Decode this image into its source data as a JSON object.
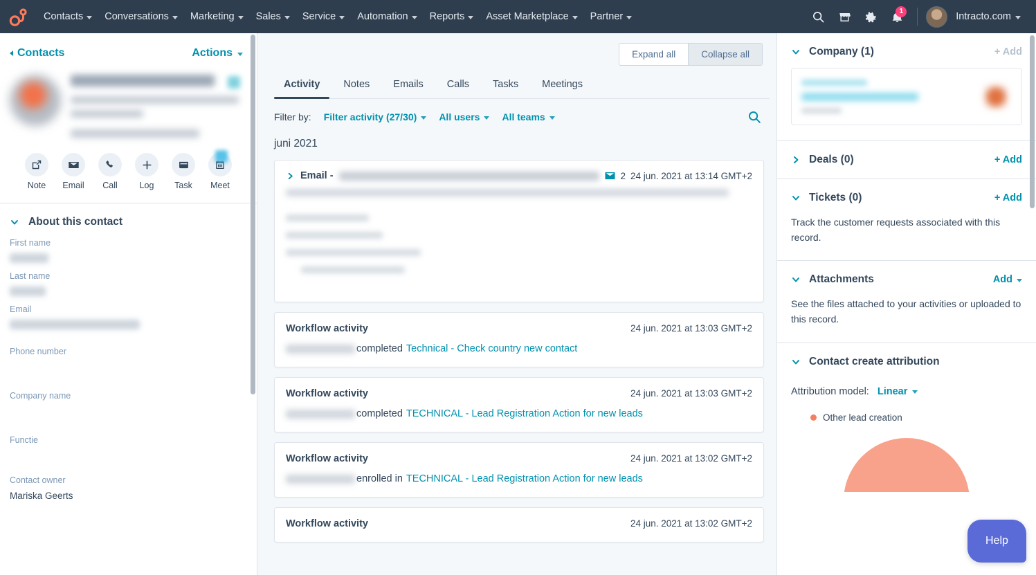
{
  "topnav": {
    "logo_icon": "hubspot-sprocket-logo",
    "items": [
      {
        "label": "Contacts",
        "icon": "chevron-down-icon"
      },
      {
        "label": "Conversations",
        "icon": "chevron-down-icon"
      },
      {
        "label": "Marketing",
        "icon": "chevron-down-icon"
      },
      {
        "label": "Sales",
        "icon": "chevron-down-icon"
      },
      {
        "label": "Service",
        "icon": "chevron-down-icon"
      },
      {
        "label": "Automation",
        "icon": "chevron-down-icon"
      },
      {
        "label": "Reports",
        "icon": "chevron-down-icon"
      },
      {
        "label": "Asset Marketplace",
        "icon": "chevron-down-icon"
      },
      {
        "label": "Partner",
        "icon": "chevron-down-icon"
      }
    ],
    "icons": {
      "search": "search-icon",
      "marketplace": "marketplace-store-icon",
      "settings": "gear-icon",
      "notifications": "bell-icon"
    },
    "notification_count": "1",
    "account_name": "Intracto.com",
    "avatar": "user-avatar"
  },
  "left": {
    "breadcrumb": "Contacts",
    "actions_label": "Actions",
    "quick_actions": [
      {
        "label": "Note",
        "icon": "note-pencil-icon"
      },
      {
        "label": "Email",
        "icon": "envelope-icon"
      },
      {
        "label": "Call",
        "icon": "phone-icon"
      },
      {
        "label": "Log",
        "icon": "plus-icon"
      },
      {
        "label": "Task",
        "icon": "task-window-icon"
      },
      {
        "label": "Meet",
        "icon": "calendar-icon"
      }
    ],
    "about_title": "About this contact",
    "properties": [
      {
        "label": "First name",
        "value": "",
        "redacted": true
      },
      {
        "label": "Last name",
        "value": "",
        "redacted": true
      },
      {
        "label": "Email",
        "value": "",
        "redacted": true
      },
      {
        "label": "Phone number",
        "value": "",
        "redacted": false
      },
      {
        "label": "Company name",
        "value": "",
        "redacted": false
      },
      {
        "label": "Functie",
        "value": "",
        "redacted": false
      },
      {
        "label": "Contact owner",
        "value": "Mariska Geerts",
        "redacted": false
      }
    ]
  },
  "center": {
    "expand_all": "Expand all",
    "collapse_all": "Collapse all",
    "active_toggle": "Collapse all",
    "tabs": [
      {
        "label": "Activity",
        "active": true
      },
      {
        "label": "Notes",
        "active": false
      },
      {
        "label": "Emails",
        "active": false
      },
      {
        "label": "Calls",
        "active": false
      },
      {
        "label": "Tasks",
        "active": false
      },
      {
        "label": "Meetings",
        "active": false
      }
    ],
    "filter_label": "Filter by:",
    "filters": [
      {
        "label": "Filter activity (27/30)"
      },
      {
        "label": "All users"
      },
      {
        "label": "All teams"
      }
    ],
    "search_icon": "search-icon",
    "month_heading": "juni 2021",
    "email_card": {
      "caret_icon": "chevron-right-icon",
      "title": "Email -",
      "subject": "",
      "attachment_icon": "envelope-icon",
      "count": "2",
      "timestamp": "24 jun. 2021 at 13:14 GMT+2"
    },
    "activities": [
      {
        "title": "Workflow activity",
        "timestamp": "24 jun. 2021 at 13:03 GMT+2",
        "actor": "",
        "verb": "completed",
        "link": "Technical - Check country new contact"
      },
      {
        "title": "Workflow activity",
        "timestamp": "24 jun. 2021 at 13:03 GMT+2",
        "actor": "",
        "verb": "completed",
        "link": "TECHNICAL - Lead Registration Action for new leads"
      },
      {
        "title": "Workflow activity",
        "timestamp": "24 jun. 2021 at 13:02 GMT+2",
        "actor": "",
        "verb": "enrolled in",
        "link": "TECHNICAL - Lead Registration Action for new leads"
      },
      {
        "title": "Workflow activity",
        "timestamp": "24 jun. 2021 at 13:02 GMT+2",
        "actor": "",
        "verb": "",
        "link": ""
      }
    ]
  },
  "right": {
    "company": {
      "title": "Company (1)",
      "add_label": "+ Add",
      "caret_icon": "chevron-down-icon"
    },
    "deals": {
      "title": "Deals (0)",
      "add_label": "+ Add",
      "caret_icon": "chevron-right-icon"
    },
    "tickets": {
      "title": "Tickets (0)",
      "add_label": "+ Add",
      "caret_icon": "chevron-down-icon",
      "text": "Track the customer requests associated with this record."
    },
    "attachments": {
      "title": "Attachments",
      "add_label": "Add",
      "caret_icon": "chevron-down-icon",
      "text": "See the files attached to your activities or uploaded to this record."
    },
    "attribution": {
      "title": "Contact create attribution",
      "caret_icon": "chevron-down-icon",
      "model_label": "Attribution model:",
      "model_value": "Linear"
    }
  },
  "chart_data": {
    "type": "pie",
    "title": "Contact create attribution",
    "categories": [
      "Other lead creation"
    ],
    "values": [
      100
    ],
    "colors": [
      "#f2805e"
    ],
    "legend_position": "top-left",
    "units": "percent"
  },
  "help": {
    "label": "Help"
  },
  "colors": {
    "nav_bg": "#2e3e4f",
    "link": "#0091ae",
    "text": "#33475b",
    "page_bg": "#f5f8fa",
    "border": "#dfe3eb",
    "badge": "#ff3f79",
    "attribution_orange": "#f2805e",
    "help_purple": "#5a6bd8"
  }
}
